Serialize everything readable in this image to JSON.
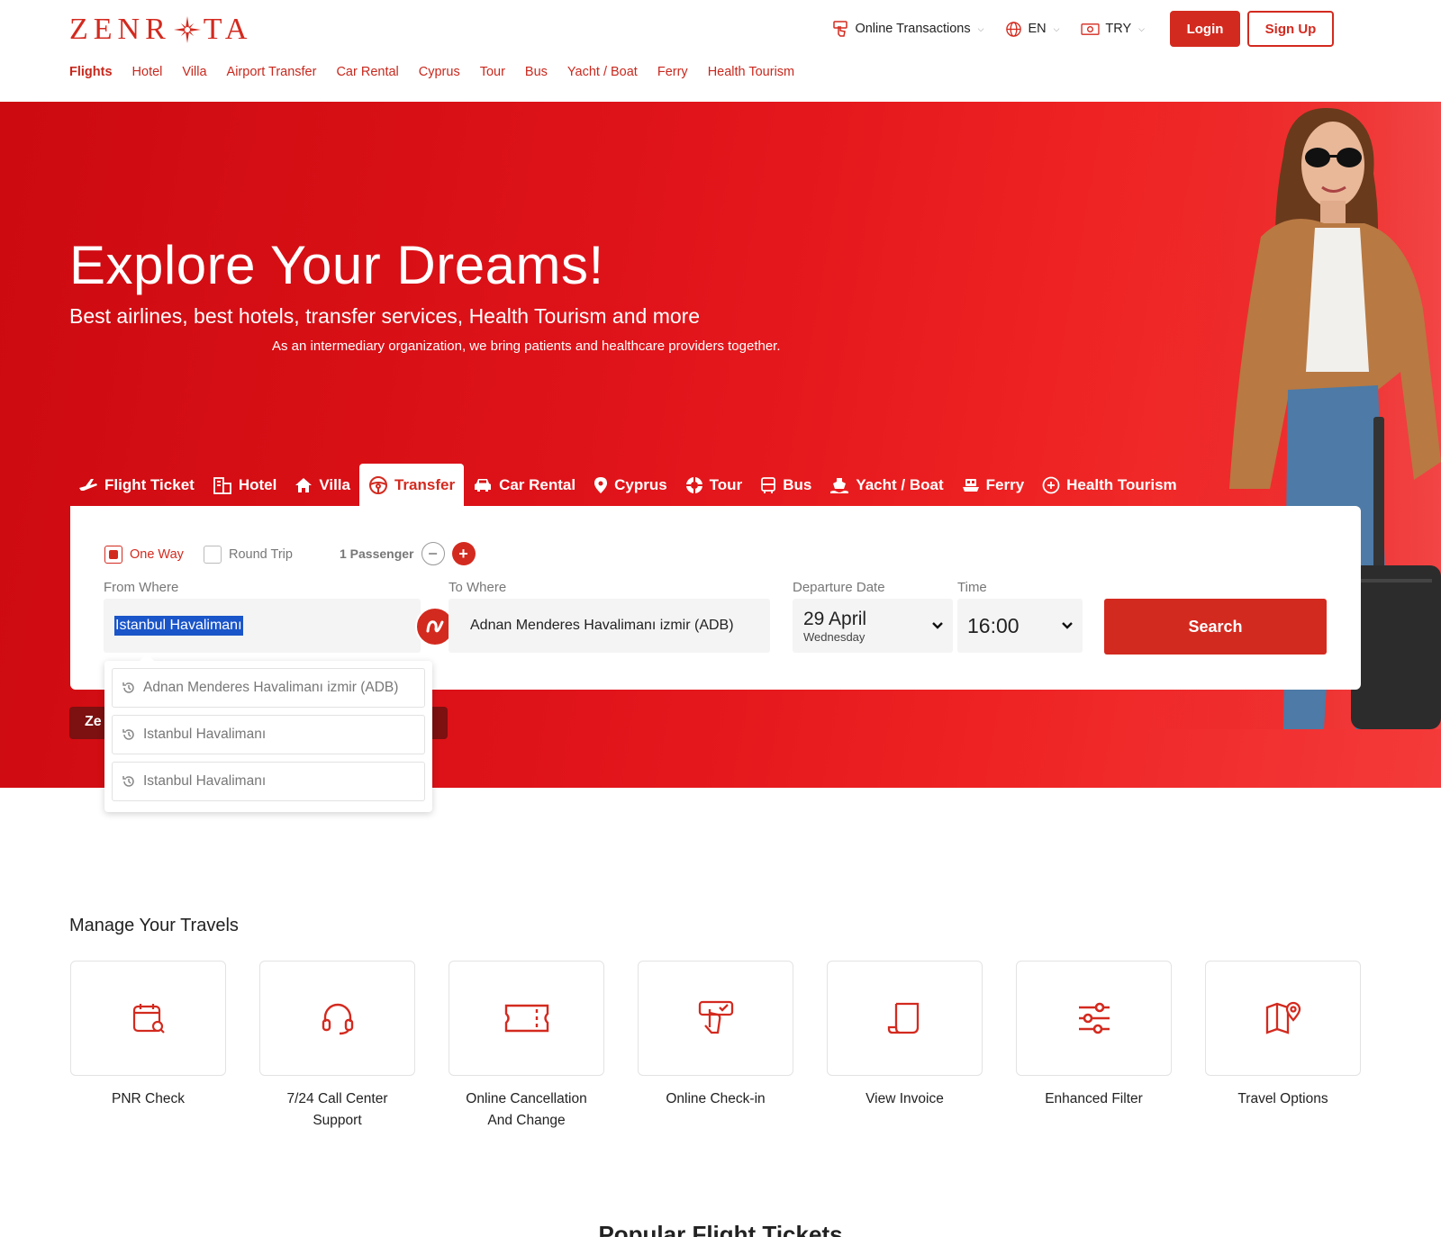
{
  "brand": {
    "logo_left": "ZENR",
    "logo_right": "TA",
    "accent": "#d32a1f"
  },
  "topnav": [
    "Flights",
    "Hotel",
    "Villa",
    "Airport Transfer",
    "Car Rental",
    "Cyprus",
    "Tour",
    "Bus",
    "Yacht / Boat",
    "Ferry",
    "Health Tourism"
  ],
  "header": {
    "online_transactions": "Online Transactions",
    "language": "EN",
    "currency": "TRY",
    "login": "Login",
    "signup": "Sign Up"
  },
  "hero": {
    "title": "Explore Your Dreams!",
    "subtitle": "Best airlines, best hotels, transfer services, Health Tourism and more",
    "note": "As an intermediary organization, we bring patients and healthcare providers together."
  },
  "tabs": [
    {
      "label": "Flight Ticket",
      "icon": "plane-icon"
    },
    {
      "label": "Hotel",
      "icon": "hotel-icon"
    },
    {
      "label": "Villa",
      "icon": "home-icon"
    },
    {
      "label": "Transfer",
      "icon": "steering-wheel-icon",
      "active": true
    },
    {
      "label": "Car Rental",
      "icon": "car-icon"
    },
    {
      "label": "Cyprus",
      "icon": "location-pin-icon"
    },
    {
      "label": "Tour",
      "icon": "lifebuoy-icon"
    },
    {
      "label": "Bus",
      "icon": "bus-icon"
    },
    {
      "label": "Yacht / Boat",
      "icon": "ship-icon"
    },
    {
      "label": "Ferry",
      "icon": "ferry-icon"
    },
    {
      "label": "Health Tourism",
      "icon": "health-plus-icon"
    }
  ],
  "search": {
    "one_way": "One Way",
    "round_trip": "Round Trip",
    "passengers": "1 Passenger",
    "from_label": "From Where",
    "from_value": "Istanbul Havalimanı",
    "to_label": "To Where",
    "to_value": "Adnan Menderes Havalimanı izmir (ADB)",
    "date_label": "Departure Date",
    "date_value": "29 April",
    "date_weekday": "Wednesday",
    "time_label": "Time",
    "time_value": "16:00",
    "button": "Search"
  },
  "dropdown": [
    "Adnan Menderes Havalimanı izmir (ADB)",
    "Istanbul Havalimanı",
    "Istanbul Havalimanı"
  ],
  "peek_text": "Ze",
  "manage": {
    "title": "Manage Your Travels",
    "cards": [
      {
        "label": "PNR Check",
        "icon": "calendar-search-icon"
      },
      {
        "label": "7/24 Call Center Support",
        "icon": "headset-icon"
      },
      {
        "label": "Online Cancellation And Change",
        "icon": "ticket-icon"
      },
      {
        "label": "Online Check-in",
        "icon": "hand-check-icon"
      },
      {
        "label": "View Invoice",
        "icon": "invoice-icon"
      },
      {
        "label": "Enhanced Filter",
        "icon": "sliders-icon"
      },
      {
        "label": "Travel Options",
        "icon": "map-pin-icon"
      }
    ]
  },
  "popular_title": "Popular Flight Tickets"
}
